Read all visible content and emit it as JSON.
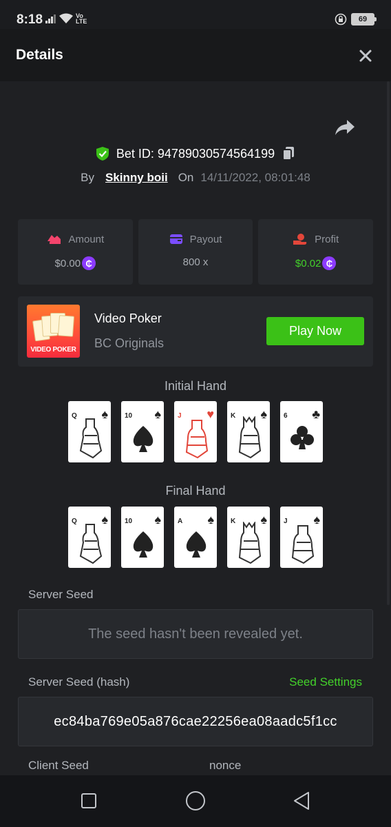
{
  "status_bar": {
    "time": "8:18",
    "battery": "69"
  },
  "header": {
    "title": "Details"
  },
  "bet": {
    "id_label": "Bet ID: 94789030574564199",
    "by_label": "By",
    "user": "Skinny boii",
    "on_label": "On",
    "date": "14/11/2022, 08:01:48"
  },
  "stats": [
    {
      "label": "Amount",
      "value": "$0.00",
      "color": "#f4446c"
    },
    {
      "label": "Payout",
      "value": "800 x",
      "color": "#7b4dff"
    },
    {
      "label": "Profit",
      "value": "$0.02",
      "color": "#e2463a"
    }
  ],
  "game": {
    "name": "Video Poker",
    "provider": "BC Originals",
    "thumb_text": "VIDEO POKER",
    "play_label": "Play Now"
  },
  "initial_hand": {
    "label": "Initial Hand",
    "cards": [
      {
        "rank": "Q",
        "suit": "♠"
      },
      {
        "rank": "10",
        "suit": "♠"
      },
      {
        "rank": "J",
        "suit": "♥"
      },
      {
        "rank": "K",
        "suit": "♠"
      },
      {
        "rank": "6",
        "suit": "♣"
      }
    ]
  },
  "final_hand": {
    "label": "Final Hand",
    "cards": [
      {
        "rank": "Q",
        "suit": "♠"
      },
      {
        "rank": "10",
        "suit": "♠"
      },
      {
        "rank": "A",
        "suit": "♠"
      },
      {
        "rank": "K",
        "suit": "♠"
      },
      {
        "rank": "J",
        "suit": "♠"
      }
    ]
  },
  "seeds": {
    "server_seed_label": "Server Seed",
    "server_seed_value": "The seed hasn't been revealed yet.",
    "server_hash_label": "Server Seed (hash)",
    "seed_settings": "Seed Settings",
    "server_hash_value": "ec84ba769e05a876cae22256ea08aadc5f1cc",
    "client_seed_label": "Client Seed",
    "nonce_label": "nonce"
  },
  "colors": {
    "accent_green": "#3bc117",
    "coin_purple": "#8c3bff",
    "verified_green": "#3bc117"
  }
}
